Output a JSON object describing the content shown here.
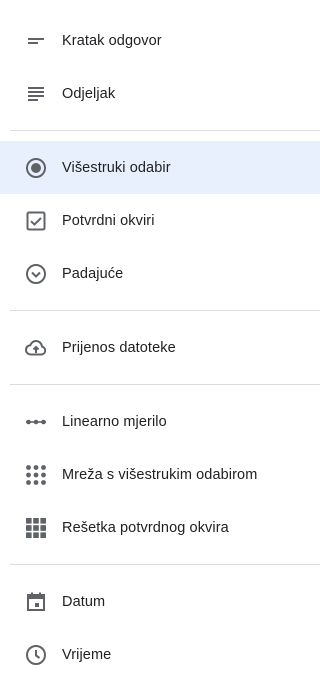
{
  "menu": {
    "items": [
      {
        "label": "Kratak odgovor",
        "icon": "short-answer-icon"
      },
      {
        "label": "Odjeljak",
        "icon": "paragraph-icon"
      },
      {
        "label": "Višestruki odabir",
        "icon": "radio-button-icon",
        "selected": true
      },
      {
        "label": "Potvrdni okviri",
        "icon": "checkbox-icon"
      },
      {
        "label": "Padajuće",
        "icon": "dropdown-icon"
      },
      {
        "label": "Prijenos datoteke",
        "icon": "cloud-upload-icon"
      },
      {
        "label": "Linearno mjerilo",
        "icon": "linear-scale-icon"
      },
      {
        "label": "Mreža s višestrukim odabirom",
        "icon": "grid-dots-icon"
      },
      {
        "label": "Rešetka potvrdnog okvira",
        "icon": "grid-squares-icon"
      },
      {
        "label": "Datum",
        "icon": "calendar-icon"
      },
      {
        "label": "Vrijeme",
        "icon": "clock-icon"
      }
    ]
  },
  "colors": {
    "icon": "#5f6368",
    "text": "#202124",
    "selected_bg": "#e8f0fe",
    "divider": "#dadce0"
  }
}
